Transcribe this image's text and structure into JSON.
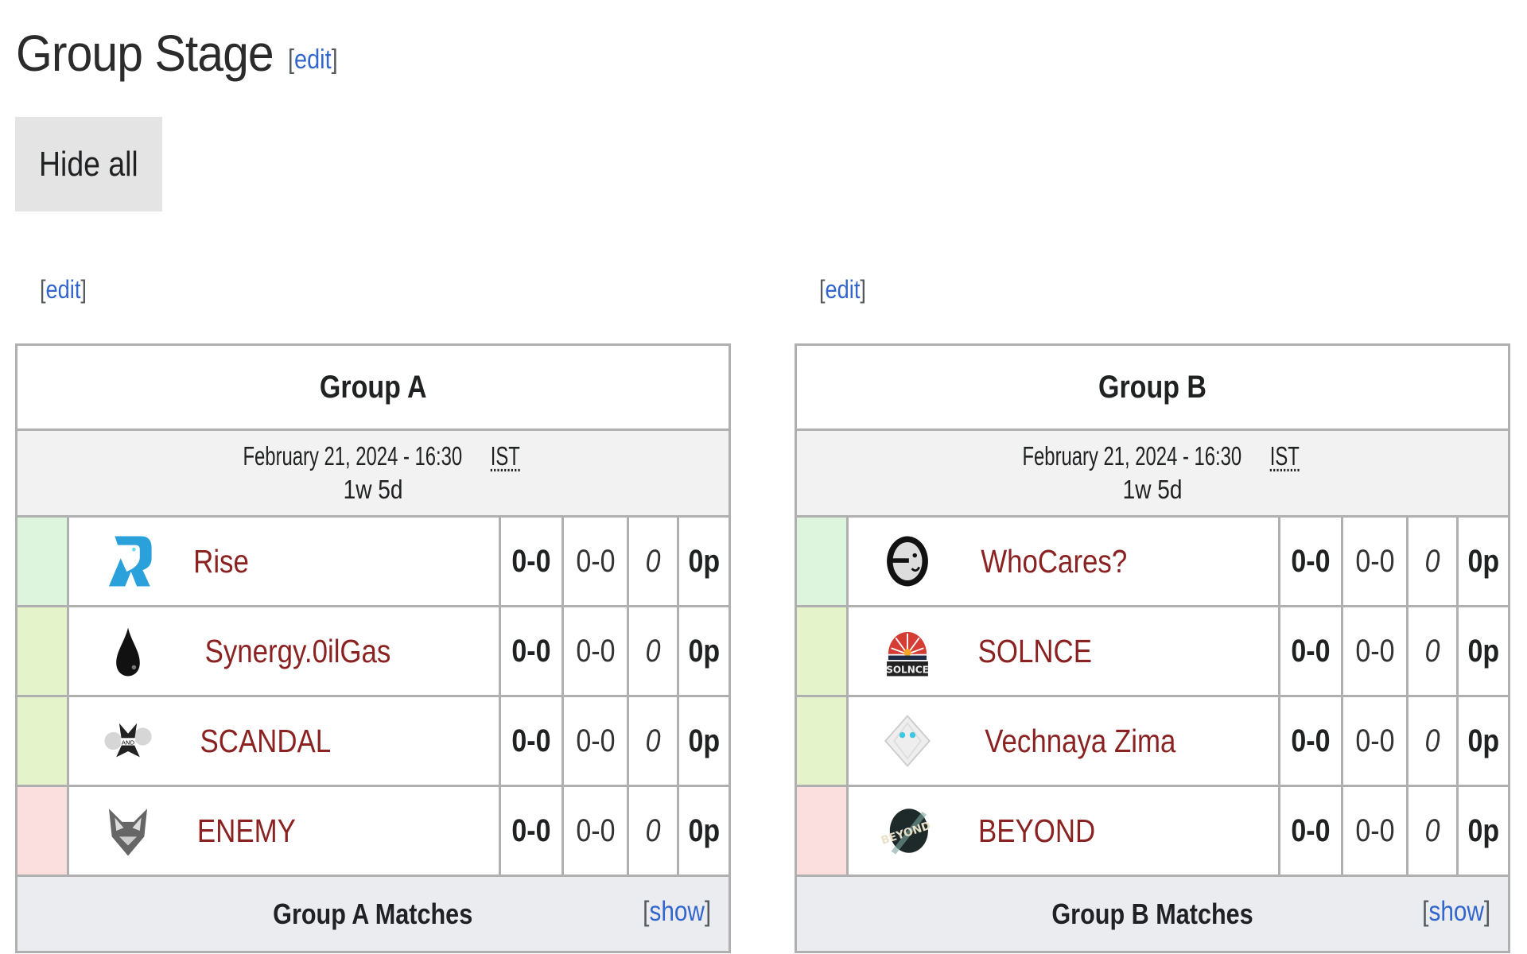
{
  "header": {
    "title": "Group Stage",
    "edit_label": "edit",
    "hide_all_label": "Hide all"
  },
  "colors": {
    "team_name": "#8b2222",
    "link": "#3366cc",
    "seed_advance_top": "#ddf4dd",
    "seed_advance": "#e5f3cb",
    "seed_eliminated": "#fbdfdf"
  },
  "groups": [
    {
      "edit_label": "edit",
      "title": "Group A",
      "date": "February 21, 2024 - 16:30",
      "timezone": "IST",
      "countdown": "1w 5d",
      "footer_label": "Group A Matches",
      "show_label": "show",
      "teams": [
        {
          "name": "Rise",
          "logo": "rise-logo-icon",
          "status": "advance-top",
          "match_score": "0-0",
          "game_score": "0-0",
          "diff": "0",
          "points": "0p"
        },
        {
          "name": "Synergy.0ilGas",
          "logo": "oil-drop-logo-icon",
          "status": "advance",
          "match_score": "0-0",
          "game_score": "0-0",
          "diff": "0",
          "points": "0p"
        },
        {
          "name": "SCANDAL",
          "logo": "scandal-logo-icon",
          "status": "advance",
          "match_score": "0-0",
          "game_score": "0-0",
          "diff": "0",
          "points": "0p"
        },
        {
          "name": "ENEMY",
          "logo": "enemy-logo-icon",
          "status": "eliminated",
          "match_score": "0-0",
          "game_score": "0-0",
          "diff": "0",
          "points": "0p"
        }
      ]
    },
    {
      "edit_label": "edit",
      "title": "Group B",
      "date": "February 21, 2024 - 16:30",
      "timezone": "IST",
      "countdown": "1w 5d",
      "footer_label": "Group B Matches",
      "show_label": "show",
      "teams": [
        {
          "name": "WhoCares?",
          "logo": "whocares-logo-icon",
          "status": "advance-top",
          "match_score": "0-0",
          "game_score": "0-0",
          "diff": "0",
          "points": "0p"
        },
        {
          "name": "SOLNCE",
          "logo": "solnce-logo-icon",
          "status": "advance",
          "match_score": "0-0",
          "game_score": "0-0",
          "diff": "0",
          "points": "0p"
        },
        {
          "name": "Vechnaya Zima",
          "logo": "vechnaya-zima-logo-icon",
          "status": "advance",
          "match_score": "0-0",
          "game_score": "0-0",
          "diff": "0",
          "points": "0p"
        },
        {
          "name": "BEYOND",
          "logo": "beyond-logo-icon",
          "status": "eliminated",
          "match_score": "0-0",
          "game_score": "0-0",
          "diff": "0",
          "points": "0p"
        }
      ]
    }
  ]
}
